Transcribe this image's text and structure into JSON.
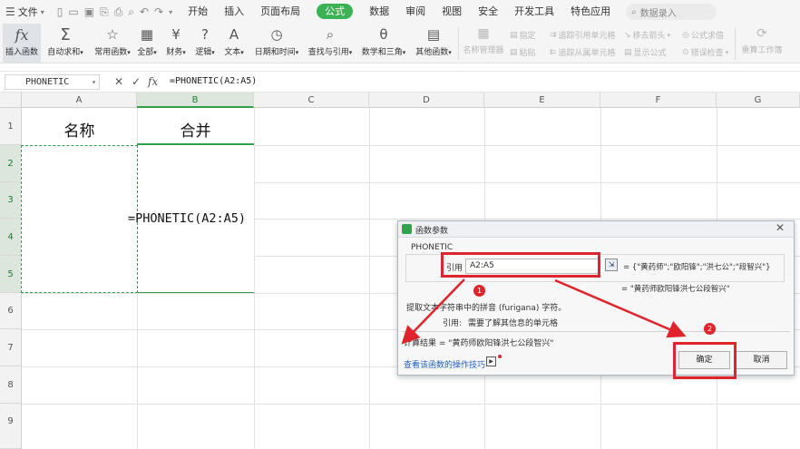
{
  "menubar": {
    "file_label": "文件",
    "tabs": [
      {
        "label": "开始"
      },
      {
        "label": "插入"
      },
      {
        "label": "页面布局"
      },
      {
        "label": "公式"
      },
      {
        "label": "数据"
      },
      {
        "label": "审阅"
      },
      {
        "label": "视图"
      },
      {
        "label": "安全"
      },
      {
        "label": "开发工具"
      },
      {
        "label": "特色应用"
      }
    ],
    "active_tab": "公式",
    "search_placeholder": "数据录入"
  },
  "ribbon": {
    "buttons": [
      {
        "label": "插入函数",
        "icon": "fx-icon"
      },
      {
        "label": "自动求和",
        "icon": "sigma-icon"
      },
      {
        "label": "常用函数",
        "icon": "star-function-icon"
      },
      {
        "label": "全部",
        "icon": "all-functions-icon"
      },
      {
        "label": "财务",
        "icon": "finance-icon"
      },
      {
        "label": "逻辑",
        "icon": "logic-icon"
      },
      {
        "label": "文本",
        "icon": "text-icon"
      },
      {
        "label": "日期和时间",
        "icon": "clock-icon"
      },
      {
        "label": "查找与引用",
        "icon": "lookup-icon"
      },
      {
        "label": "数学和三角",
        "icon": "math-icon"
      },
      {
        "label": "其他函数",
        "icon": "more-functions-icon"
      }
    ],
    "name_manager": "名称管理器",
    "specify": "指定",
    "paste": "粘贴",
    "trace_precedents": "追踪引用单元格",
    "trace_dependents": "追踪从属单元格",
    "remove_arrows": "移去箭头",
    "show_formulas": "显示公式",
    "evaluate_formula": "公式求值",
    "error_check": "错误检查",
    "recalc": "重算工作簿"
  },
  "formula_bar": {
    "name_box": "PHONETIC",
    "formula": "=PHONETIC(A2:A5)"
  },
  "sheet": {
    "columns": [
      "A",
      "B",
      "C",
      "D",
      "E",
      "F",
      "G"
    ],
    "rows": [
      "1",
      "2",
      "3",
      "4",
      "5",
      "6",
      "7",
      "8",
      "9"
    ],
    "a1": "名称",
    "b1": "合并",
    "b2_formula": "=PHONETIC(A2:A5)"
  },
  "dialog": {
    "title": "函数参数",
    "function_name": "PHONETIC",
    "arg_label": "引用",
    "arg_value": "A2:A5",
    "arg_result": "= {\"黄药师\";\"欧阳锋\";\"洪七公\";\"段智兴\"}",
    "preview_result": "= \"黄药师欧阳锋洪七公段智兴\"",
    "description": "提取文本字符串中的拼音 (furigana) 字符。",
    "param_desc_label": "引用:",
    "param_desc": "需要了解其信息的单元格",
    "calc_result": "计算结果 = \"黄药师欧阳锋洪七公段智兴\"",
    "help_link": "查看该函数的操作技巧",
    "ok_label": "确定",
    "cancel_label": "取消"
  },
  "annotations": {
    "badge_1": "1",
    "badge_2": "2",
    "color": "#e0242c"
  }
}
